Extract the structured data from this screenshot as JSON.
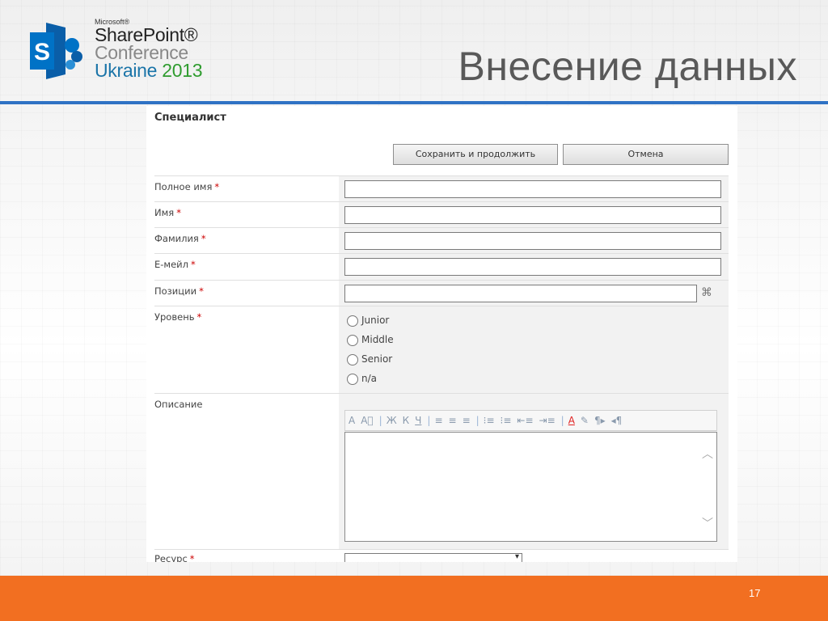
{
  "logo": {
    "microsoft": "Microsoft®",
    "sharepoint": "SharePoint®",
    "conference": "Conference",
    "ukraine": "Ukraine",
    "year": "2013",
    "colors": {
      "mark": "#0072c6",
      "accent_year": "#2f9c2f"
    }
  },
  "slide": {
    "title": "Внесение данных",
    "page_number": "17",
    "colors": {
      "rule": "#2f72c4",
      "footer": "#f26f21"
    }
  },
  "form": {
    "title": "Специалист",
    "buttons": {
      "save": "Сохранить и продолжить",
      "cancel": "Отмена"
    },
    "required_mark": "*",
    "fields": {
      "full_name": {
        "label": "Полное имя",
        "value": ""
      },
      "first_name": {
        "label": "Имя",
        "value": ""
      },
      "last_name": {
        "label": "Фамилия",
        "value": ""
      },
      "email": {
        "label": "Е-мейл",
        "value": ""
      },
      "positions": {
        "label": "Позиции",
        "value": "",
        "icon": "address-book-icon"
      },
      "level": {
        "label": "Уровень",
        "options": [
          "Junior",
          "Middle",
          "Senior",
          "n/a"
        ],
        "selected": null
      },
      "description": {
        "label": "Описание",
        "value": ""
      },
      "resource": {
        "label": "Ресурс",
        "value": ""
      }
    },
    "toolbar": {
      "font": "A",
      "font_size": "A⃞",
      "bold": "Ж",
      "italic": "К",
      "underline": "Ч",
      "align_left": "≡",
      "align_center": "≡",
      "align_right": "≡",
      "numbered_list": "⁝≡",
      "bullet_list": "⁝≡",
      "decrease_indent": "⇤≡",
      "increase_indent": "⇥≡",
      "text_color": "A",
      "highlight": "✎",
      "ltr": "¶▸",
      "rtl": "◂¶"
    }
  }
}
